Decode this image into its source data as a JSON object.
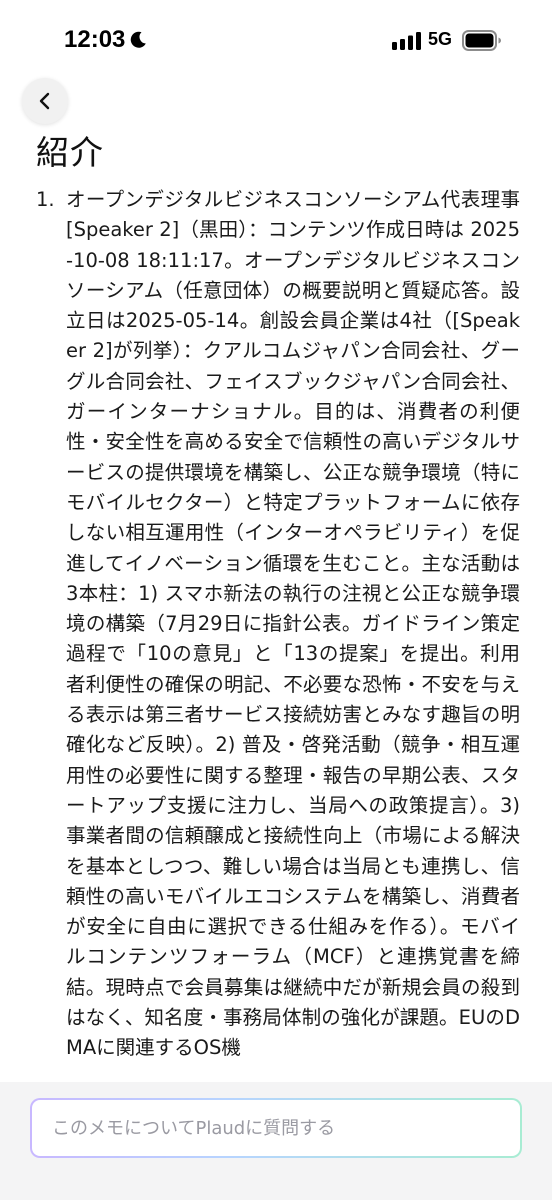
{
  "status_bar": {
    "time": "12:03",
    "network": "5G"
  },
  "page": {
    "title": "紹介"
  },
  "summary": {
    "items": [
      {
        "number": "1.",
        "text": "オープンデジタルビジネスコンソーシアム代表理事 [Speaker 2]（黒田）：コンテンツ作成日時は 2025-10-08 18:11:17。オープンデジタルビジネスコンソーシアム（任意団体）の概要説明と質疑応答。設立日は2025-05-14。創設会員企業は4社（[Speaker 2]が列挙）：クアルコムジャパン合同会社、グーグル合同会社、フェイスブックジャパン合同会社、ガーインターナショナル。目的は、消費者の利便性・安全性を高める安全で信頼性の高いデジタルサービスの提供環境を構築し、公正な競争環境（特にモバイルセクター）と特定プラットフォームに依存しない相互運用性（インターオペラビリティ）を促進してイノベーション循環を生むこと。主な活動は3本柱：1) スマホ新法の執行の注視と公正な競争環境の構築（7月29日に指針公表。ガイドライン策定過程で「10の意見」と「13の提案」を提出。利用者利便性の確保の明記、不必要な恐怖・不安を与える表示は第三者サービス接続妨害とみなす趣旨の明確化など反映）。2) 普及・啓発活動（競争・相互運用性の必要性に関する整理・報告の早期公表、スタートアップ支援に注力し、当局への政策提言）。3) 事業者間の信頼醸成と接続性向上（市場による解決を基本としつつ、難しい場合は当局とも連携し、信頼性の高いモバイルエコシステムを構築し、消費者が安全に自由に選択できる仕組みを作る）。モバイルコンテンツフォーラム（MCF）と連携覚書を締結。現時点で会員募集は継続中だが新規会員の殺到はなく、知名度・事務局体制の強化が課題。EUのDMAに関連するOS機"
      }
    ]
  },
  "ask_bar": {
    "placeholder": "このメモについてPlaudに質問する",
    "value": ""
  }
}
